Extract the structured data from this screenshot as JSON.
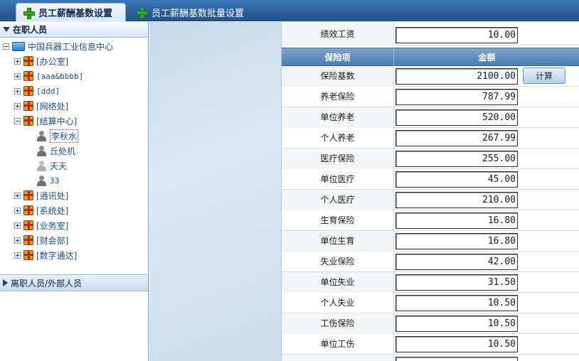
{
  "tabs": [
    {
      "label": "员工薪酬基数设置",
      "active": true
    },
    {
      "label": "员工薪酬基数批量设置",
      "active": false
    }
  ],
  "left_panel": {
    "title": "在职人员",
    "root": "中国兵器工业信息中心",
    "nodes": [
      {
        "label": "[办公室]",
        "expanded": false
      },
      {
        "label": "[aaa&bbbb]",
        "expanded": false
      },
      {
        "label": "[ddd]",
        "expanded": false
      },
      {
        "label": "[网络处]",
        "expanded": false
      },
      {
        "label": "[结算中心]",
        "expanded": true
      },
      {
        "label": "[通讯处]",
        "expanded": false
      },
      {
        "label": "[系统处]",
        "expanded": false
      },
      {
        "label": "[业务室]",
        "expanded": false
      },
      {
        "label": "[财会部]",
        "expanded": false
      },
      {
        "label": "[数字通达]",
        "expanded": false
      }
    ],
    "people": [
      "李秋水",
      "丘处机",
      "天天",
      "33"
    ],
    "selected_person": "李秋水",
    "second_section": "离职人员/外部人员"
  },
  "form": {
    "top_row": {
      "label": "绩效工资",
      "value": "10.00"
    },
    "header": {
      "item": "保险项",
      "amount": "金额"
    },
    "calc_button": "计算",
    "rows": [
      {
        "label": "保险基数",
        "value": "2100.00"
      },
      {
        "label": "养老保险",
        "value": "787.99"
      },
      {
        "label": "单位养老",
        "value": "520.00"
      },
      {
        "label": "个人养老",
        "value": "267.99"
      },
      {
        "label": "医疗保险",
        "value": "255.00"
      },
      {
        "label": "单位医疗",
        "value": "45.00"
      },
      {
        "label": "个人医疗",
        "value": "210.00"
      },
      {
        "label": "生育保险",
        "value": "16.80"
      },
      {
        "label": "单位生育",
        "value": "16.80"
      },
      {
        "label": "失业保险",
        "value": "42.00"
      },
      {
        "label": "单位失业",
        "value": "31.50"
      },
      {
        "label": "个人失业",
        "value": "10.50"
      },
      {
        "label": "工伤保险",
        "value": "10.50"
      },
      {
        "label": "单位工伤",
        "value": "10.50"
      }
    ]
  },
  "colors": {
    "tab_bar": "#2b5f9b",
    "table_header": "#5d88bd",
    "tree_text": "#1b4f8f"
  }
}
